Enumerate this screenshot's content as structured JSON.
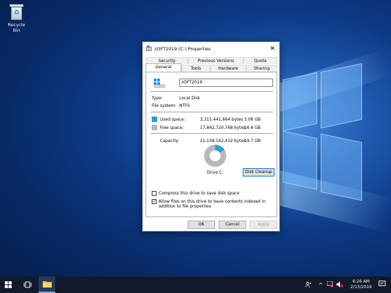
{
  "desktop": {
    "recycle_bin_label": "Recycle Bin"
  },
  "dialog": {
    "title": "zOFT2019 (C:) Properties",
    "tabs_top": [
      "Security",
      "Previous Versions",
      "Quota"
    ],
    "tabs_bottom": [
      "General",
      "Tools",
      "Hardware",
      "Sharing"
    ],
    "active_tab": "General",
    "drive_name": "zOFT2019",
    "type_label": "Type:",
    "type_value": "Local Disk",
    "fs_label": "File system:",
    "fs_value": "NTFS",
    "used_label": "Used space:",
    "used_bytes": "3,315,441,664 bytes",
    "used_gb": "3.08 GB",
    "free_label": "Free space:",
    "free_bytes": "17,842,720,768 bytes",
    "free_gb": "16.6 GB",
    "capacity_label": "Capacity:",
    "capacity_bytes": "21,158,162,432 bytes",
    "capacity_gb": "19.7 GB",
    "used_fraction": 0.157,
    "drive_label": "Drive C:",
    "cleanup_button": "Disk Cleanup",
    "compress_label": "Compress this drive to save disk space",
    "compress_checked": false,
    "index_label": "Allow files on this drive to have contents indexed in addition to file properties",
    "index_checked": true,
    "ok_button": "OK",
    "cancel_button": "Cancel",
    "apply_button": "Apply",
    "colors": {
      "used": "#26a0da",
      "free": "#b8b8b8"
    }
  },
  "taskbar": {
    "time": "6:26 AM",
    "date": "2/13/2019",
    "icons": [
      "start-icon",
      "task-view-icon",
      "file-explorer-icon"
    ],
    "tray_icons": [
      "people-icon",
      "chevron-up-icon",
      "network-icon",
      "volume-icon",
      "notifications-icon"
    ]
  }
}
